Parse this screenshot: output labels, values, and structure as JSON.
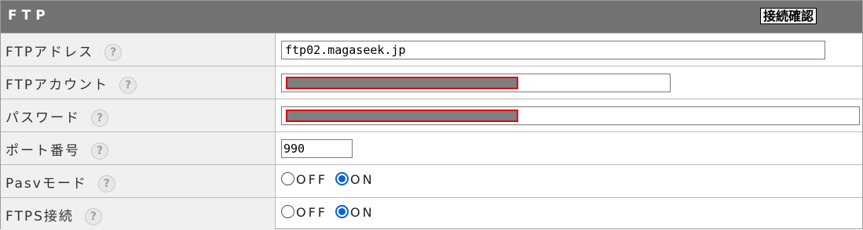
{
  "header": {
    "title": "FTP",
    "connect_button": "接続確認"
  },
  "rows": [
    {
      "label": "FTPアドレス",
      "help": "?",
      "value": "ftp02.magaseek.jp"
    },
    {
      "label": "FTPアカウント",
      "help": "?",
      "value": "",
      "masked": true
    },
    {
      "label": "パスワード",
      "help": "?",
      "value": "",
      "masked": true
    },
    {
      "label": "ポート番号",
      "help": "?",
      "value": "990"
    },
    {
      "label": "Pasvモード",
      "help": "?",
      "options": [
        "OFF",
        "ON"
      ],
      "selected": "ON"
    },
    {
      "label": "FTPS接続",
      "help": "?",
      "options": [
        "OFF",
        "ON"
      ],
      "selected": "ON"
    }
  ],
  "colors": {
    "header_bg": "#737373",
    "label_bg": "#f0f0f0",
    "mask_fill": "#7f7f7f",
    "mask_border": "#e00000",
    "radio_accent": "#0a62d6"
  }
}
